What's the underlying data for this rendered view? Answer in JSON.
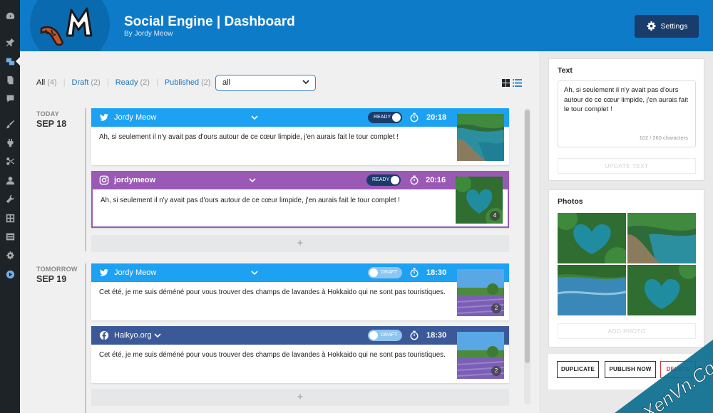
{
  "header": {
    "title": "Social Engine | Dashboard",
    "subtitle": "By Jordy Meow",
    "settings_label": "Settings",
    "logo_text": "M"
  },
  "filters": [
    {
      "label": "All",
      "count": "(4)",
      "current": true
    },
    {
      "label": "Draft",
      "count": "(2)",
      "current": false
    },
    {
      "label": "Ready",
      "count": "(2)",
      "current": false
    },
    {
      "label": "Published",
      "count": "(2)",
      "current": false
    }
  ],
  "select": {
    "value": "all"
  },
  "days": [
    {
      "label": "TODAY",
      "date": "SEP 18"
    },
    {
      "label": "TOMORROW",
      "date": "SEP 19"
    }
  ],
  "posts": [
    {
      "network": "twitter",
      "account": "Jordy Meow",
      "status": "READY",
      "time": "20:18",
      "text": "Ah, si seulement il n'y avait pas d'ours autour de ce cœur limpide, j'en aurais fait le tour complet !",
      "photo_count": "",
      "color": "#1da1f2"
    },
    {
      "network": "instagram",
      "account": "jordymeow",
      "status": "READY",
      "time": "20:16",
      "text": "Ah, si seulement il n'y avait pas d'ours autour de ce cœur limpide, j'en aurais fait le tour complet !",
      "photo_count": "4",
      "color": "#9b59b6"
    },
    {
      "network": "twitter",
      "account": "Jordy Meow",
      "status": "DRAFT",
      "time": "18:30",
      "text": "Cet été, je me suis déméné pour vous trouver des champs de lavandes à Hokkaido qui ne sont pas touristiques.",
      "photo_count": "2",
      "color": "#1da1f2"
    },
    {
      "network": "facebook",
      "account": "Haikyo.org",
      "status": "DRAFT",
      "time": "18:30",
      "text": "Cet été, je me suis déméné pour vous trouver des champs de lavandes à Hokkaido qui ne sont pas touristiques.",
      "photo_count": "2",
      "color": "#3b5998"
    }
  ],
  "add_label": "+",
  "editor": {
    "text_title": "Text",
    "text_value": "Ah, si seulement il n'y avait pas d'ours autour de ce cœur limpide, j'en aurais fait le tour complet !",
    "char_count": "102 / 260 characters",
    "update_label": "UPDATE TEXT",
    "photos_title": "Photos",
    "add_photo_label": "ADD PHOTO",
    "duplicate_label": "DUPLICATE",
    "publish_label": "PUBLISH NOW",
    "delete_label": "DELETE"
  },
  "watermark": "XenVn.Com",
  "colors": {
    "header_bg": "#0e7bc9",
    "settings_bg": "#1a3c6b",
    "twitter": "#1da1f2",
    "instagram": "#9b59b6",
    "facebook": "#3b5998",
    "ready_toggle": "#1a3c6b",
    "draft_toggle": "#8ec5ef"
  }
}
